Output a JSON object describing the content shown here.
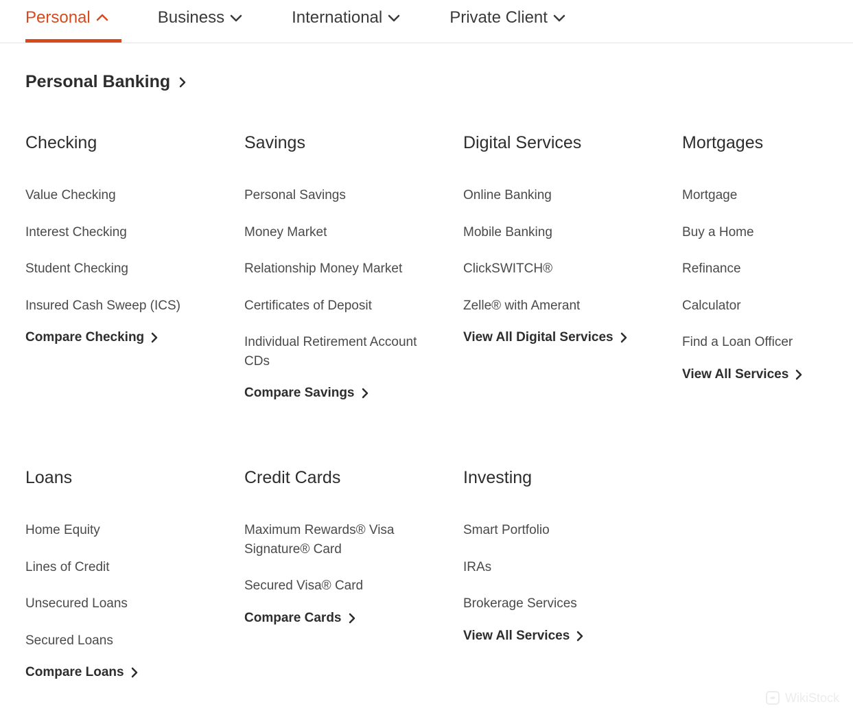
{
  "nav": {
    "tabs": [
      {
        "label": "Personal",
        "active": true
      },
      {
        "label": "Business",
        "active": false
      },
      {
        "label": "International",
        "active": false
      },
      {
        "label": "Private Client",
        "active": false
      }
    ]
  },
  "breadcrumb": {
    "title": "Personal Banking"
  },
  "sections_row1": {
    "checking": {
      "heading": "Checking",
      "links": [
        "Value Checking",
        "Interest Checking",
        "Student Checking",
        "Insured Cash Sweep (ICS)"
      ],
      "action": "Compare Checking"
    },
    "savings": {
      "heading": "Savings",
      "links": [
        "Personal Savings",
        "Money Market",
        "Relationship Money Market",
        "Certificates of Deposit",
        "Individual Retirement Account CDs"
      ],
      "action": "Compare Savings"
    },
    "digital": {
      "heading": "Digital Services",
      "links": [
        "Online Banking",
        "Mobile Banking",
        "ClickSWITCH®",
        "Zelle® with Amerant"
      ],
      "action": "View All Digital Services"
    },
    "mortgages": {
      "heading": "Mortgages",
      "links": [
        "Mortgage",
        "Buy a Home",
        "Refinance",
        "Calculator",
        "Find a Loan Officer"
      ],
      "action": "View All Services"
    }
  },
  "sections_row2": {
    "loans": {
      "heading": "Loans",
      "links": [
        "Home Equity",
        "Lines of Credit",
        "Unsecured Loans",
        "Secured Loans"
      ],
      "action": "Compare Loans"
    },
    "credit": {
      "heading": "Credit Cards",
      "links": [
        "Maximum Rewards® Visa Signature® Card",
        "Secured Visa® Card"
      ],
      "action": "Compare Cards"
    },
    "investing": {
      "heading": "Investing",
      "links": [
        "Smart Portfolio",
        "IRAs",
        "Brokerage Services"
      ],
      "action": "View All Services"
    }
  },
  "watermark": "WikiStock"
}
